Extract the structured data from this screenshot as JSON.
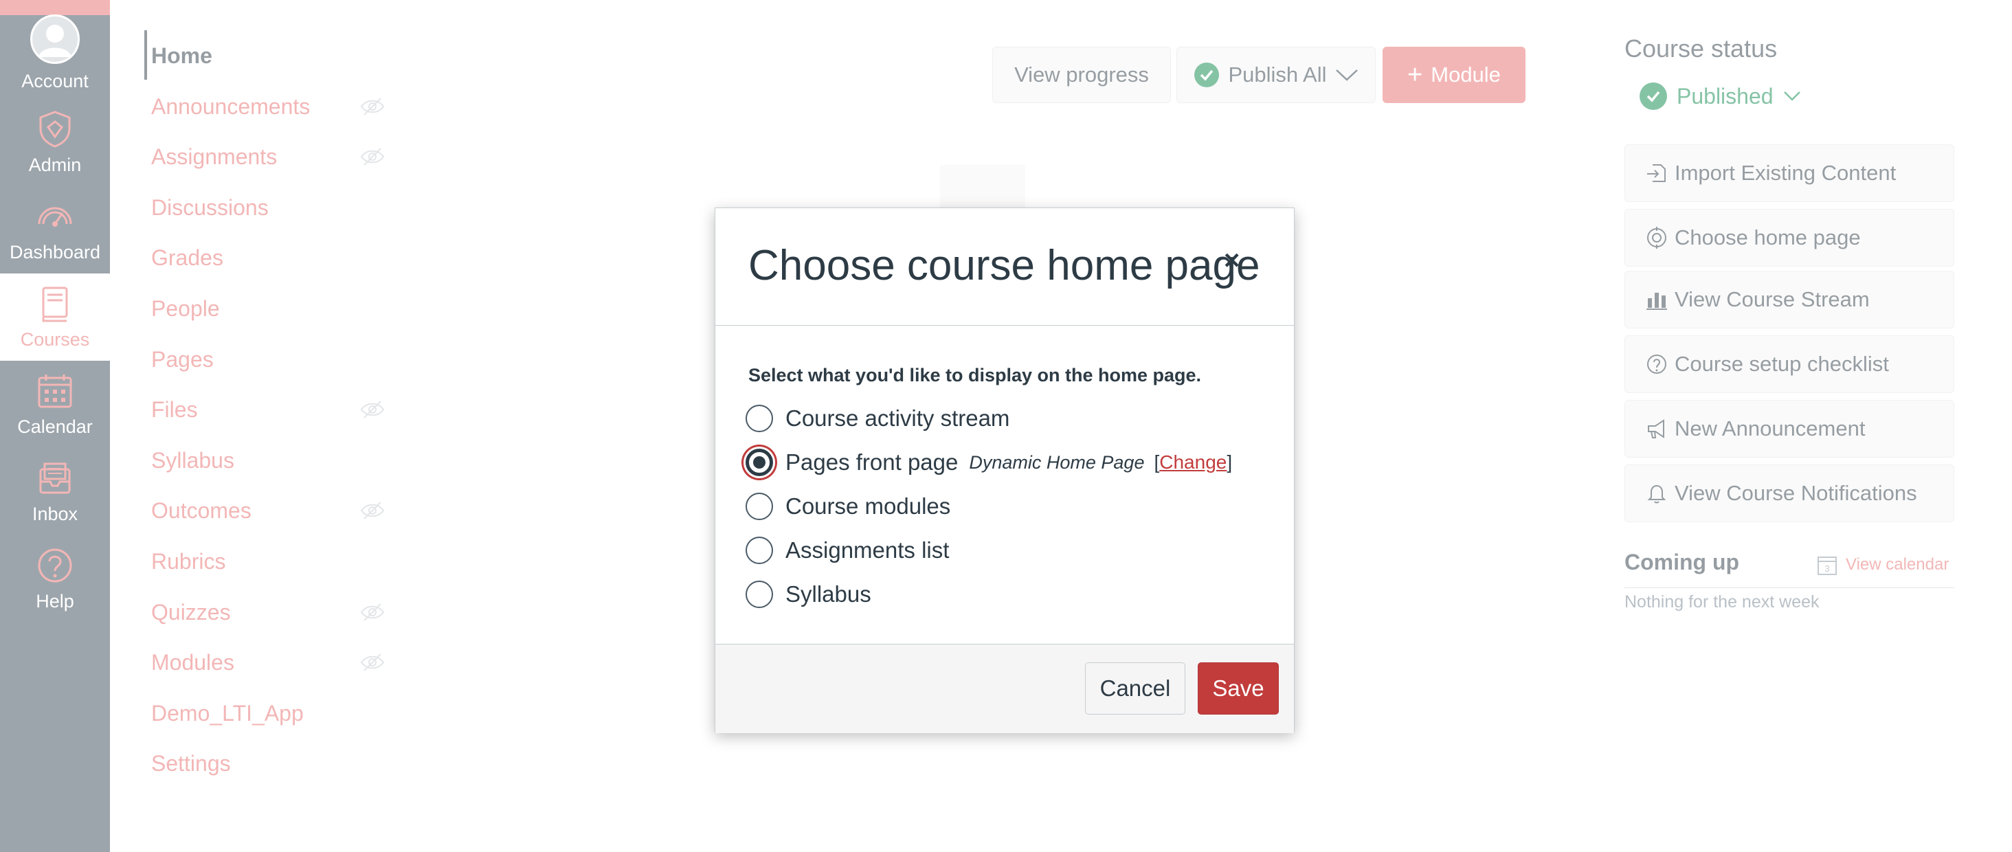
{
  "global_nav": {
    "items": [
      {
        "label": "Account",
        "icon": "avatar-icon"
      },
      {
        "label": "Admin",
        "icon": "shield-icon"
      },
      {
        "label": "Dashboard",
        "icon": "speedometer-icon"
      },
      {
        "label": "Courses",
        "icon": "book-icon"
      },
      {
        "label": "Calendar",
        "icon": "calendar-icon"
      },
      {
        "label": "Inbox",
        "icon": "inbox-icon"
      },
      {
        "label": "Help",
        "icon": "question-icon"
      }
    ],
    "active": "Courses"
  },
  "course_nav": {
    "items": [
      {
        "label": "Home"
      },
      {
        "label": "Announcements"
      },
      {
        "label": "Assignments"
      },
      {
        "label": "Discussions"
      },
      {
        "label": "Grades"
      },
      {
        "label": "People"
      },
      {
        "label": "Pages"
      },
      {
        "label": "Files"
      },
      {
        "label": "Syllabus"
      },
      {
        "label": "Outcomes"
      },
      {
        "label": "Rubrics"
      },
      {
        "label": "Quizzes"
      },
      {
        "label": "Modules"
      },
      {
        "label": "Demo_LTI_App"
      },
      {
        "label": "Settings"
      }
    ]
  },
  "toolbar": {
    "view_progress": "View progress",
    "publish_all": "Publish All",
    "module": "Module"
  },
  "sidebar": {
    "course_status": "Course status",
    "published": "Published",
    "buttons": [
      {
        "label": "Import Existing Content",
        "icon": "import-icon"
      },
      {
        "label": "Choose home page",
        "icon": "target-icon"
      },
      {
        "label": "View Course Stream",
        "icon": "bar-chart-icon"
      },
      {
        "label": "Course setup checklist",
        "icon": "question-icon"
      },
      {
        "label": "New Announcement",
        "icon": "megaphone-icon"
      },
      {
        "label": "View Course Notifications",
        "icon": "bell-icon"
      }
    ],
    "coming_up": "Coming up",
    "view_calendar": "View calendar",
    "calendar_day": "3",
    "nothing_next": "Nothing for the next week"
  },
  "modal": {
    "title": "Choose course home page",
    "close": "×",
    "prompt": "Select what you'd like to display on the home page.",
    "options": [
      {
        "label": "Course activity stream",
        "checked": false
      },
      {
        "label": "Pages front page",
        "checked": true,
        "sub": "Dynamic Home Page",
        "change": "Change"
      },
      {
        "label": "Course modules",
        "checked": false
      },
      {
        "label": "Assignments list",
        "checked": false
      },
      {
        "label": "Syllabus",
        "checked": false
      }
    ],
    "cancel": "Cancel",
    "save": "Save"
  },
  "colors": {
    "nav_bg": "#394b58",
    "brand": "#e66d6d",
    "save": "#c23c3c",
    "published": "#0b874b"
  }
}
